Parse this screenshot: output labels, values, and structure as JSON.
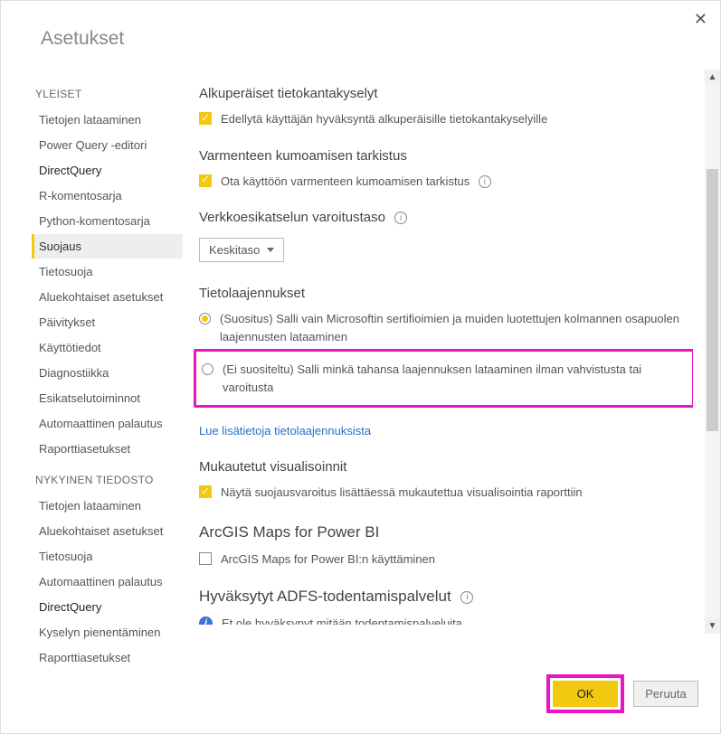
{
  "dialog": {
    "title": "Asetukset"
  },
  "sidebar": {
    "section1": "YLEISET",
    "items1": [
      "Tietojen lataaminen",
      "Power Query -editori",
      "DirectQuery",
      "R-komentosarja",
      "Python-komentosarja",
      "Suojaus",
      "Tietosuoja",
      "Aluekohtaiset asetukset",
      "Päivitykset",
      "Käyttötiedot",
      "Diagnostiikka",
      "Esikatselutoiminnot",
      "Automaattinen palautus",
      "Raporttiasetukset"
    ],
    "section2": "NYKYINEN TIEDOSTO",
    "items2": [
      "Tietojen lataaminen",
      "Aluekohtaiset asetukset",
      "Tietosuoja",
      "Automaattinen palautus",
      "DirectQuery",
      "Kyselyn pienentäminen",
      "Raporttiasetukset"
    ]
  },
  "content": {
    "sec1_h": "Alkuperäiset tietokantakyselyt",
    "sec1_cb": "Edellytä käyttäjän hyväksyntä alkuperäisille tietokantakyselyille",
    "sec2_h": "Varmenteen kumoamisen tarkistus",
    "sec2_cb": "Ota käyttöön varmenteen kumoamisen tarkistus",
    "sec3_h": "Verkkoesikatselun varoitustaso",
    "sec3_dd": "Keskitaso",
    "sec4_h": "Tietolaajennukset",
    "sec4_r1": "(Suositus) Salli vain Microsoftin sertifioimien ja muiden luotettujen kolmannen osapuolen laajennusten lataaminen",
    "sec4_r2": "(Ei suositeltu) Salli minkä tahansa laajennuksen lataaminen ilman vahvistusta tai varoitusta",
    "sec4_link": "Lue lisätietoja tietolaajennuksista",
    "sec5_h": "Mukautetut visualisoinnit",
    "sec5_cb": "Näytä suojausvaroitus lisättäessä mukautettua visualisointia raporttiin",
    "sec6_h": "ArcGIS Maps for Power BI",
    "sec6_cb": "ArcGIS Maps for Power BI:n käyttäminen",
    "sec7_h": "Hyväksytyt ADFS-todentamispalvelut",
    "sec7_txt": "Et ole hyväksynyt mitään todentamispalveluita"
  },
  "footer": {
    "ok": "OK",
    "cancel": "Peruuta"
  }
}
